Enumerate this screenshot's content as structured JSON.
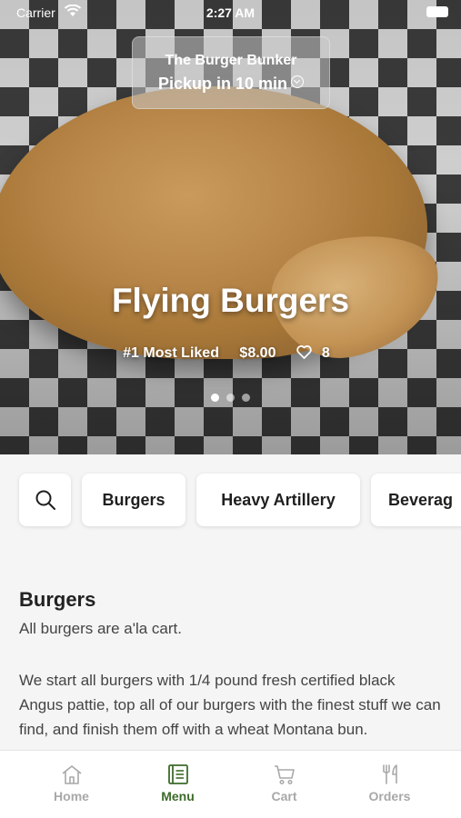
{
  "status_bar": {
    "carrier": "Carrier",
    "time": "2:27 AM"
  },
  "location": {
    "name": "The Burger Bunker",
    "pickup": "Pickup in 10 min"
  },
  "hero": {
    "title": "Flying Burgers",
    "rank": "#1 Most Liked",
    "price": "$8.00",
    "likes": "8",
    "slide_count": 3,
    "active_slide": 1
  },
  "categories": {
    "items": [
      "Burgers",
      "Heavy Artillery",
      "Beverag"
    ]
  },
  "section": {
    "title": "Burgers",
    "subtitle": "All burgers are a'la cart.",
    "description": "We start all burgers with 1/4 pound fresh certified black Angus pattie, top all of our burgers with the finest stuff we can find, and finish them off with a wheat Montana bun."
  },
  "tabs": [
    {
      "label": "Home",
      "icon": "home-icon",
      "active": false
    },
    {
      "label": "Menu",
      "icon": "menu-book-icon",
      "active": true
    },
    {
      "label": "Cart",
      "icon": "cart-icon",
      "active": false
    },
    {
      "label": "Orders",
      "icon": "fork-knife-icon",
      "active": false
    }
  ],
  "colors": {
    "accent": "#3d6b2a",
    "inactive_tab": "#a8a8a8",
    "background": "#f5f5f5"
  }
}
